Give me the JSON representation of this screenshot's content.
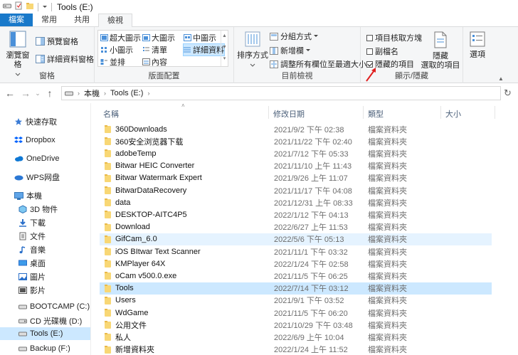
{
  "window": {
    "title": "Tools (E:)"
  },
  "tabs": [
    {
      "label": "檔案"
    },
    {
      "label": "常用"
    },
    {
      "label": "共用"
    },
    {
      "label": "檢視"
    }
  ],
  "ribbon": {
    "panes": {
      "nav_pane": "瀏覽窗格",
      "preview_pane": "預覽窗格",
      "details_pane": "詳細資料窗格",
      "group_label": "窗格"
    },
    "layout": {
      "extra_large": "超大圖示",
      "large": "大圖示",
      "medium": "中圖示",
      "small": "小圖示",
      "list": "清單",
      "details": "詳細資料",
      "tiles": "並排",
      "content": "內容",
      "group_label": "版面配置"
    },
    "current_view": {
      "sort_by": "排序方式",
      "group_by": "分組方式",
      "add_columns": "新增欄",
      "size_all_columns": "調整所有欄位至最適大小",
      "group_label": "目前檢視"
    },
    "show_hide": {
      "item_checkboxes": "項目核取方塊",
      "item_checkboxes_checked": false,
      "file_extensions": "副檔名",
      "file_extensions_checked": false,
      "hidden_items": "隱藏的項目",
      "hidden_items_checked": true,
      "hide_selected_line1": "隱藏",
      "hide_selected_line2": "選取的項目",
      "group_label": "顯示/隱藏"
    },
    "options": "選項"
  },
  "address": {
    "crumbs": [
      "本機",
      "Tools (E:)"
    ]
  },
  "sidebar": {
    "items": [
      {
        "label": "快速存取",
        "icon": "star-icon"
      },
      {
        "label": "Dropbox",
        "icon": "dropbox-icon"
      },
      {
        "label": "OneDrive",
        "icon": "cloud-icon"
      },
      {
        "label": "WPS网盘",
        "icon": "wps-cloud-icon"
      },
      {
        "label": "本機",
        "icon": "computer-icon"
      },
      {
        "label": "3D 物件",
        "icon": "3d-objects-icon"
      },
      {
        "label": "下載",
        "icon": "download-icon"
      },
      {
        "label": "文件",
        "icon": "document-icon"
      },
      {
        "label": "音樂",
        "icon": "music-icon"
      },
      {
        "label": "桌面",
        "icon": "desktop-icon"
      },
      {
        "label": "圖片",
        "icon": "pictures-icon"
      },
      {
        "label": "影片",
        "icon": "video-icon"
      },
      {
        "label": "BOOTCAMP (C:)",
        "icon": "drive-icon"
      },
      {
        "label": "CD 光碟機 (D:)",
        "icon": "cd-drive-icon"
      },
      {
        "label": "Tools (E:)",
        "icon": "drive-icon"
      },
      {
        "label": "Backup (F:)",
        "icon": "drive-icon"
      }
    ]
  },
  "columns": {
    "name": "名稱",
    "date": "修改日期",
    "type": "類型",
    "size": "大小"
  },
  "files": [
    {
      "name": "360Downloads",
      "date": "2021/9/2 下午 02:38",
      "type": "檔案資料夾"
    },
    {
      "name": "360安全浏览器下载",
      "date": "2021/11/22 下午 02:40",
      "type": "檔案資料夾"
    },
    {
      "name": "adobeTemp",
      "date": "2021/7/12 下午 05:33",
      "type": "檔案資料夾"
    },
    {
      "name": "Bitwar HEIC Converter",
      "date": "2021/11/10 上午 11:43",
      "type": "檔案資料夾"
    },
    {
      "name": "Bitwar Watermark Expert",
      "date": "2021/9/26 上午 11:07",
      "type": "檔案資料夾"
    },
    {
      "name": "BitwarDataRecovery",
      "date": "2021/11/17 下午 04:08",
      "type": "檔案資料夾"
    },
    {
      "name": "data",
      "date": "2021/12/31 上午 08:33",
      "type": "檔案資料夾"
    },
    {
      "name": "DESKTOP-AITC4P5",
      "date": "2022/1/12 下午 04:13",
      "type": "檔案資料夾"
    },
    {
      "name": "Download",
      "date": "2022/6/27 上午 11:53",
      "type": "檔案資料夾"
    },
    {
      "name": "GifCam_6.0",
      "date": "2022/5/6 下午 05:13",
      "type": "檔案資料夾"
    },
    {
      "name": "iOS BItwar Text Scanner",
      "date": "2021/11/1 下午 03:32",
      "type": "檔案資料夾"
    },
    {
      "name": "KMPlayer 64X",
      "date": "2022/1/24 下午 02:58",
      "type": "檔案資料夾"
    },
    {
      "name": "oCam v500.0.exe",
      "date": "2021/11/5 下午 06:25",
      "type": "檔案資料夾"
    },
    {
      "name": "Tools",
      "date": "2022/7/14 下午 03:12",
      "type": "檔案資料夾"
    },
    {
      "name": "Users",
      "date": "2021/9/1 下午 03:52",
      "type": "檔案資料夾"
    },
    {
      "name": "WdGame",
      "date": "2021/11/5 下午 06:20",
      "type": "檔案資料夾"
    },
    {
      "name": "公用文件",
      "date": "2021/10/29 下午 03:48",
      "type": "檔案資料夾"
    },
    {
      "name": "私人",
      "date": "2022/6/9 上午 10:04",
      "type": "檔案資料夾"
    },
    {
      "name": "新增資料夾",
      "date": "2022/1/24 上午 11:52",
      "type": "檔案資料夾"
    }
  ],
  "colors": {
    "accent": "#1979ca",
    "selection": "#cce8ff",
    "hover": "#e5f3ff",
    "folder": "#f8d775",
    "annotation_arrow": "#e02020"
  }
}
